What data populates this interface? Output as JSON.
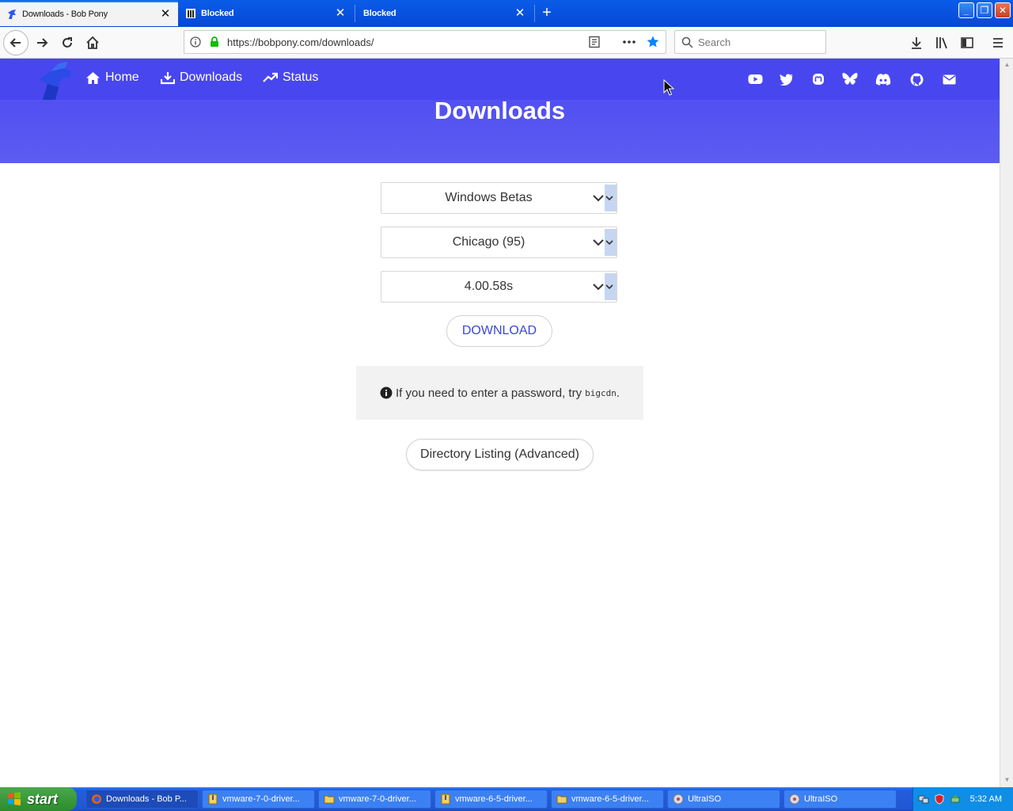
{
  "browser": {
    "tabs": [
      {
        "label": "Downloads - Bob Pony",
        "active": true,
        "icon": "bobpony-favicon-icon"
      },
      {
        "label": "Blocked",
        "active": false,
        "icon": "blocked-page-icon"
      },
      {
        "label": "Blocked",
        "active": false,
        "icon": "none"
      }
    ],
    "new_tab": "+",
    "url": "https://bobpony.com/downloads/",
    "search_placeholder": "Search"
  },
  "site": {
    "nav": [
      {
        "label": "Home",
        "icon": "home-icon"
      },
      {
        "label": "Downloads",
        "icon": "download-icon"
      },
      {
        "label": "Status",
        "icon": "trend-icon"
      }
    ],
    "social_icons": [
      "youtube-icon",
      "twitter-icon",
      "mastodon-icon",
      "bluesky-icon",
      "discord-icon",
      "github-icon",
      "mail-icon"
    ],
    "title": "Downloads",
    "accent_color": "#4a48f0"
  },
  "form": {
    "category": "Windows Betas",
    "product": "Chicago (95)",
    "build": "4.00.58s",
    "download_label": "DOWNLOAD",
    "info_text": "If you need to enter a password, try",
    "info_code": "bigcdn",
    "info_suffix": ".",
    "directory_label": "Directory Listing (Advanced)"
  },
  "taskbar": {
    "start_label": "start",
    "tasks": [
      {
        "label": "Downloads - Bob P...",
        "icon": "firefox-icon",
        "active": true
      },
      {
        "label": "vmware-7-0-driver...",
        "icon": "archive-icon",
        "active": false
      },
      {
        "label": "vmware-7-0-driver...",
        "icon": "folder-icon",
        "active": false
      },
      {
        "label": "vmware-6-5-driver...",
        "icon": "archive-icon",
        "active": false
      },
      {
        "label": "vmware-6-5-driver...",
        "icon": "folder-icon",
        "active": false
      },
      {
        "label": "UltraISO",
        "icon": "disc-icon",
        "active": false
      },
      {
        "label": "UltraISO",
        "icon": "disc-icon",
        "active": false
      }
    ],
    "clock": "5:32 AM"
  }
}
